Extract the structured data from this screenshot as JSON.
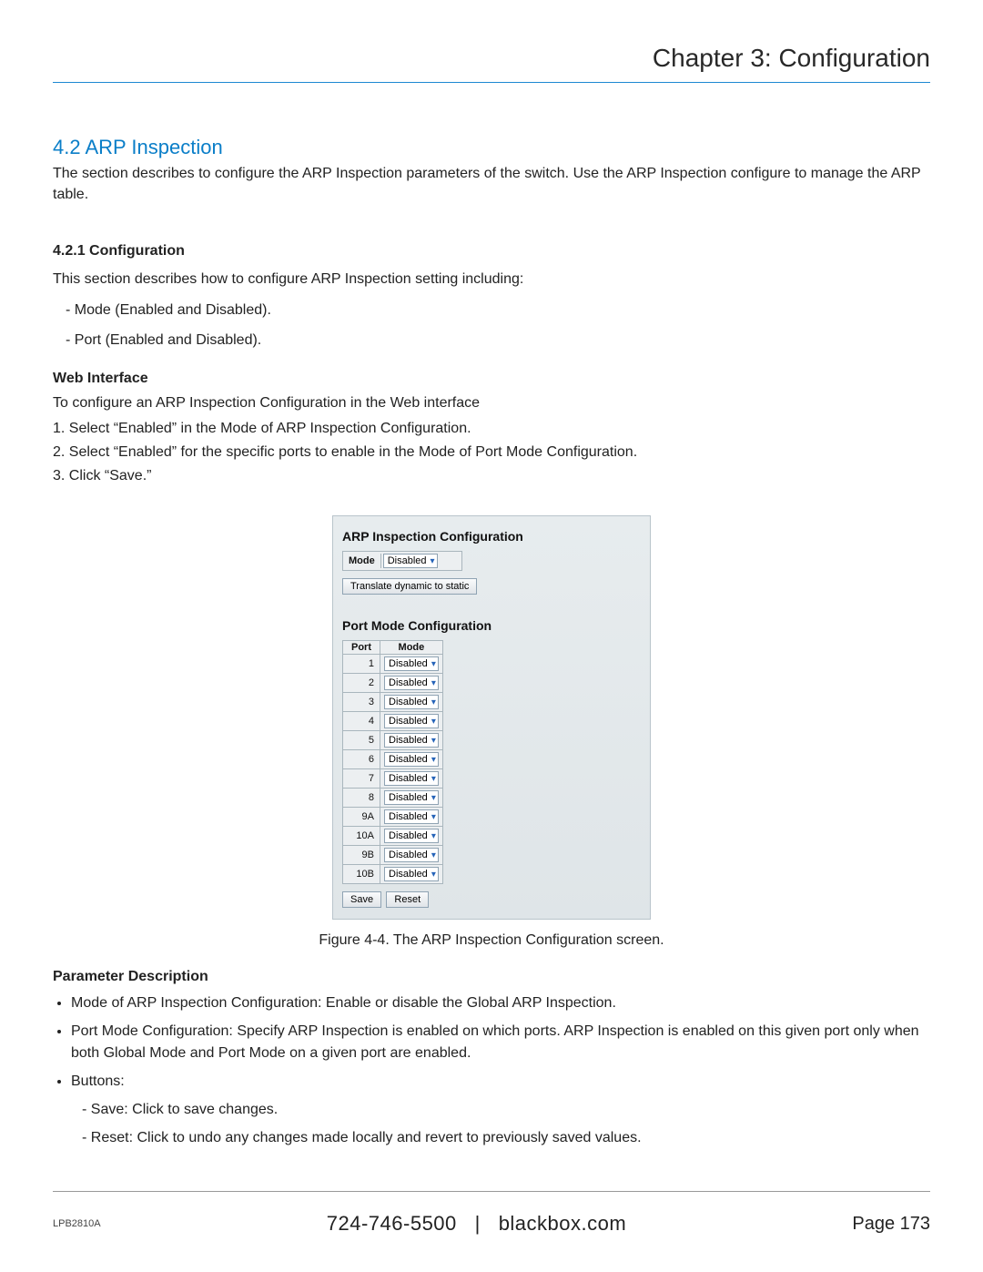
{
  "header": {
    "chapter": "Chapter 3: Configuration"
  },
  "section": {
    "number_title": "4.2 ARP Inspection",
    "intro": "The section describes to configure the ARP Inspection parameters of the switch. Use the ARP Inspection configure to manage the ARP table."
  },
  "config_section": {
    "heading": "4.2.1 Configuration",
    "lead": "This section describes how to configure ARP Inspection setting including:",
    "items": [
      "Mode (Enabled and Disabled).",
      "Port (Enabled and Disabled)."
    ]
  },
  "web_interface": {
    "heading": "Web Interface",
    "lead": "To configure an ARP Inspection Configuration in the Web interface",
    "steps": [
      "1. Select “Enabled” in the Mode of ARP Inspection Configuration.",
      "2. Select “Enabled” for the specific ports to enable in the Mode of Port Mode Configuration.",
      "3. Click “Save.”"
    ]
  },
  "screenshot": {
    "title1": "ARP Inspection Configuration",
    "mode_label": "Mode",
    "mode_value": "Disabled",
    "translate_btn": "Translate dynamic to static",
    "title2": "Port Mode Configuration",
    "col_port": "Port",
    "col_mode": "Mode",
    "ports": [
      {
        "port": "1",
        "mode": "Disabled"
      },
      {
        "port": "2",
        "mode": "Disabled"
      },
      {
        "port": "3",
        "mode": "Disabled"
      },
      {
        "port": "4",
        "mode": "Disabled"
      },
      {
        "port": "5",
        "mode": "Disabled"
      },
      {
        "port": "6",
        "mode": "Disabled"
      },
      {
        "port": "7",
        "mode": "Disabled"
      },
      {
        "port": "8",
        "mode": "Disabled"
      },
      {
        "port": "9A",
        "mode": "Disabled"
      },
      {
        "port": "10A",
        "mode": "Disabled"
      },
      {
        "port": "9B",
        "mode": "Disabled"
      },
      {
        "port": "10B",
        "mode": "Disabled"
      }
    ],
    "save_btn": "Save",
    "reset_btn": "Reset"
  },
  "figure_caption": "Figure 4-4. The ARP Inspection Configuration screen.",
  "params": {
    "heading": "Parameter Description",
    "bullets": [
      "Mode of ARP Inspection Configuration: Enable or disable the Global ARP Inspection.",
      "Port Mode Configuration: Specify ARP Inspection is enabled on which ports. ARP Inspection is enabled on this given port only when both Global Mode and Port Mode on a given port are enabled.",
      "Buttons:"
    ],
    "button_items": [
      "Save: Click to save changes.",
      "Reset: Click to undo any changes made locally and revert to previously saved values."
    ]
  },
  "footer": {
    "model": "LPB2810A",
    "phone": "724-746-5500",
    "sep": "|",
    "site": "blackbox.com",
    "page_label": "Page 173"
  }
}
